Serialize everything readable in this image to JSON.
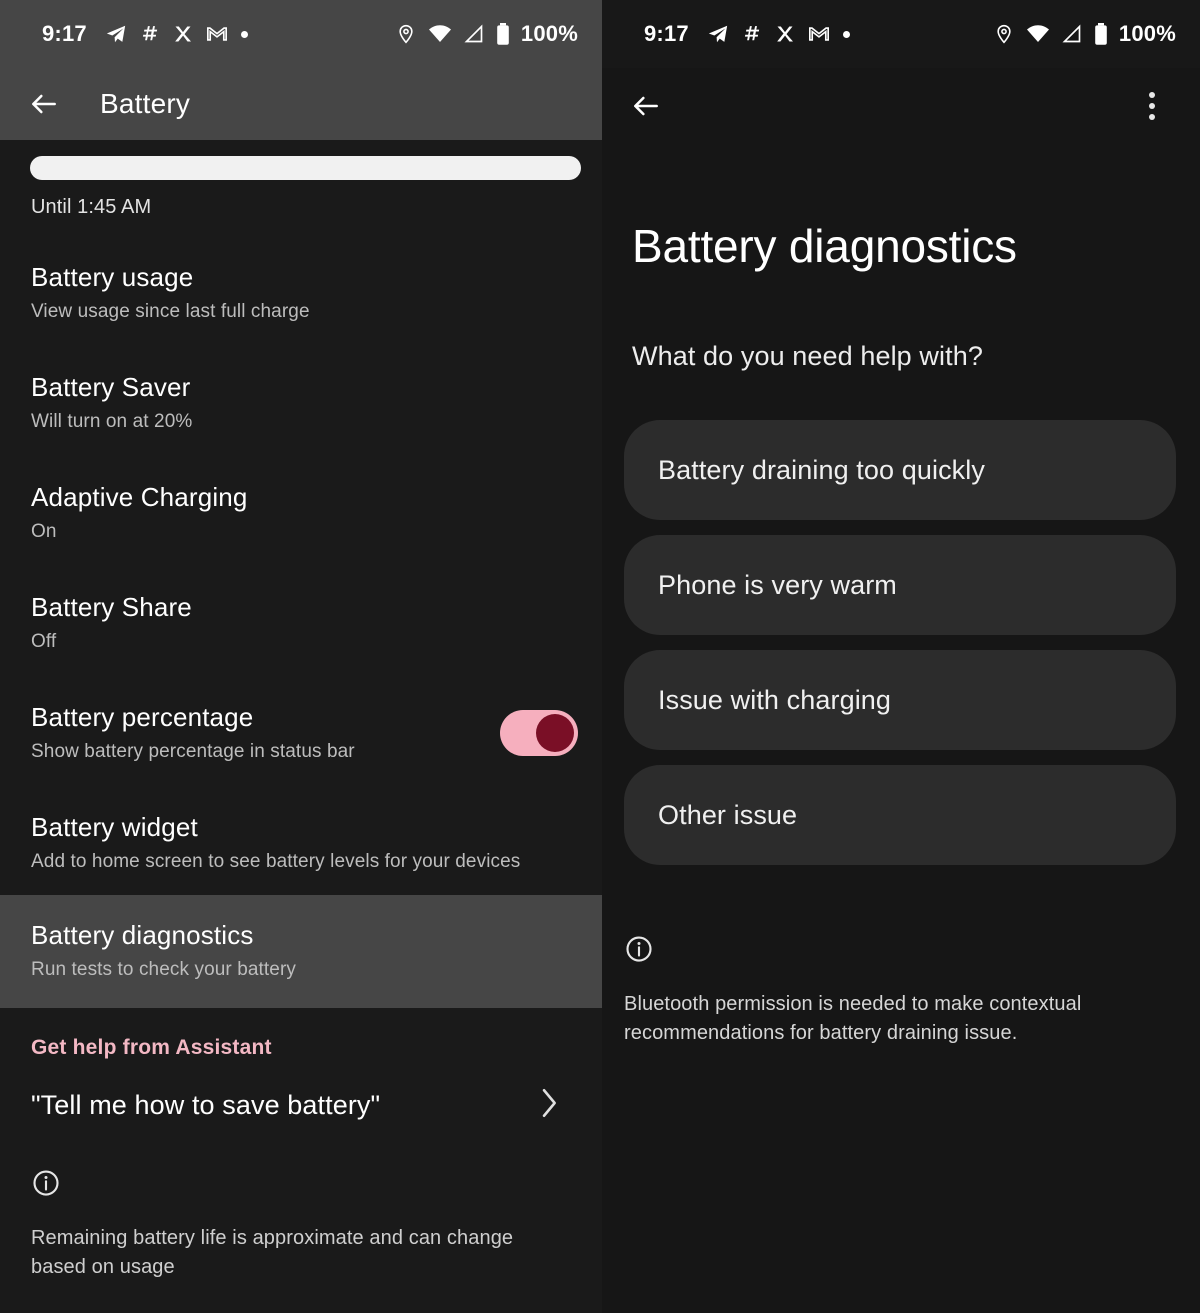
{
  "status_bar": {
    "time": "9:17",
    "battery_percent": "100%",
    "left_icons": [
      "telegram-icon",
      "slack-icon",
      "x-icon",
      "gmail-icon",
      "notification-dot-icon"
    ],
    "right_icons": [
      "location-icon",
      "wifi-icon",
      "mobile-signal-icon",
      "battery-icon"
    ]
  },
  "left_panel": {
    "app_bar": {
      "title": "Battery",
      "back_icon": "back-arrow-icon"
    },
    "battery_estimate": {
      "level_percent": 100,
      "until_label": "Until 1:45 AM"
    },
    "settings": [
      {
        "title": "Battery usage",
        "subtitle": "View usage since last full charge",
        "control": "none"
      },
      {
        "title": "Battery Saver",
        "subtitle": "Will turn on at 20%",
        "control": "none"
      },
      {
        "title": "Adaptive Charging",
        "subtitle": "On",
        "control": "none"
      },
      {
        "title": "Battery Share",
        "subtitle": "Off",
        "control": "none"
      },
      {
        "title": "Battery percentage",
        "subtitle": "Show battery percentage in status bar",
        "control": "switch",
        "switch_on": true
      },
      {
        "title": "Battery widget",
        "subtitle": "Add to home screen to see battery levels for your devices",
        "control": "none"
      }
    ],
    "highlighted_item": {
      "title": "Battery diagnostics",
      "subtitle": "Run tests to check your battery"
    },
    "assistant": {
      "section_header": "Get help from Assistant",
      "query": "\"Tell me how to save battery\"",
      "chevron_icon": "chevron-right-icon"
    },
    "footnote": {
      "icon": "info-icon",
      "text": "Remaining battery life is approximate and can change based on usage"
    }
  },
  "right_panel": {
    "app_bar": {
      "back_icon": "back-arrow-icon",
      "overflow_icon": "overflow-menu-icon"
    },
    "page_title": "Battery diagnostics",
    "question": "What do you need help with?",
    "options": [
      "Battery draining too quickly",
      "Phone is very warm",
      "Issue with charging",
      "Other issue"
    ],
    "footnote": {
      "icon": "info-icon",
      "text": "Bluetooth permission is needed to make contextual recommendations for battery draining issue."
    }
  },
  "colors": {
    "accent_pink": "#f3b8c4",
    "switch_track": "#f6afbe",
    "switch_knob": "#7a0f26",
    "surface_dark": "#1a1a1a",
    "surface_chip": "#2c2c2c",
    "surface_grey": "#464646"
  }
}
